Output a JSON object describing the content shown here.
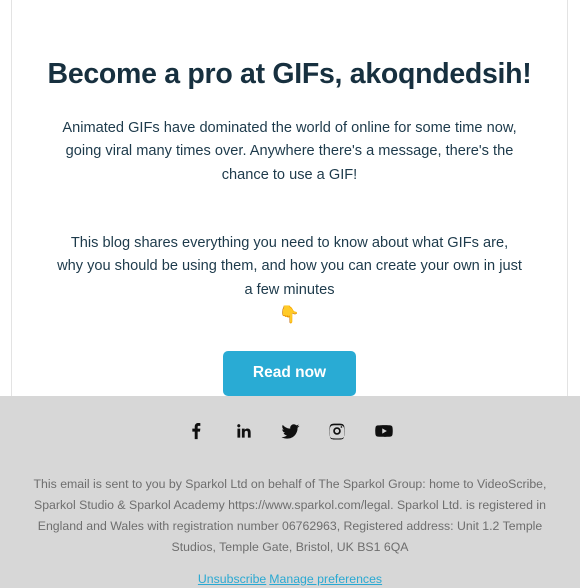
{
  "email": {
    "headline": "Become a pro at GIFs, akoqndedsih!",
    "paragraph_1": "Animated GIFs have dominated the world of online for some time now, going viral many times over. Anywhere there's a message, there's the chance to use a GIF!",
    "paragraph_2": "This blog shares everything you need to know about what GIFs are, why you should be using them, and how you can create your own in just a few minutes",
    "emoji": "👇",
    "cta_label": "Read now",
    "accent_color": "#29abd4",
    "headline_color": "#17303f",
    "footer_background": "#d7d7d7"
  },
  "social": {
    "items": [
      {
        "name": "facebook",
        "title": "Facebook"
      },
      {
        "name": "linkedin",
        "title": "LinkedIn"
      },
      {
        "name": "twitter",
        "title": "Twitter"
      },
      {
        "name": "instagram",
        "title": "Instagram"
      },
      {
        "name": "youtube",
        "title": "YouTube"
      }
    ]
  },
  "footer": {
    "legal_line_1": "This email is sent to you by Sparkol Ltd on behalf of The Sparkol Group: home to",
    "legal_line_2": "VideoScribe, Sparkol Studio & Sparkol Academy https://www.sparkol.com/legal. Sparkol Ltd.",
    "legal_line_3": "is registered in England and Wales with registration number 06762963, Registered address:",
    "legal_line_4": "Unit 1.2 Temple Studios, Temple Gate, Bristol, UK BS1 6QA",
    "unsubscribe_label": "Unsubscribe",
    "manage_label": "Manage preferences",
    "link_color": "#2aa9d2"
  }
}
